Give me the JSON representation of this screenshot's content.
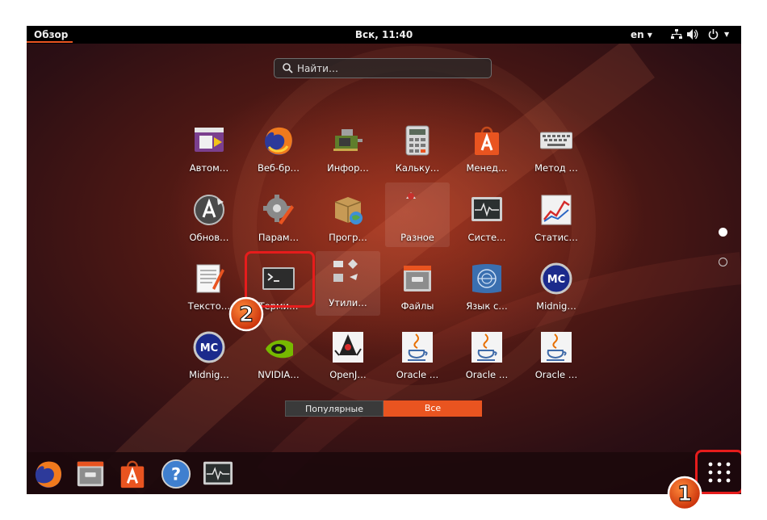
{
  "topbar": {
    "activities": "Обзор",
    "clock": "Вск, 11:40",
    "lang": "en"
  },
  "search": {
    "placeholder": "Найти…"
  },
  "apps": [
    {
      "label": "Автом…",
      "icon": "autostart-icon"
    },
    {
      "label": "Веб-бр…",
      "icon": "firefox-icon"
    },
    {
      "label": "Инфор…",
      "icon": "hardware-info-icon"
    },
    {
      "label": "Кальку…",
      "icon": "calculator-icon"
    },
    {
      "label": "Менед…",
      "icon": "software-center-icon"
    },
    {
      "label": "Метод …",
      "icon": "keyboard-icon"
    },
    {
      "label": "Обнов…",
      "icon": "software-updater-icon"
    },
    {
      "label": "Парам…",
      "icon": "settings-icon"
    },
    {
      "label": "Прогр…",
      "icon": "software-properties-icon"
    },
    {
      "label": "Разное",
      "icon": "misc-folder-icon"
    },
    {
      "label": "Систе…",
      "icon": "system-monitor-icon"
    },
    {
      "label": "Статис…",
      "icon": "statistics-icon"
    },
    {
      "label": "Тексто…",
      "icon": "text-editor-icon"
    },
    {
      "label": "Терми…",
      "icon": "terminal-icon"
    },
    {
      "label": "Утили…",
      "icon": "utilities-folder-icon"
    },
    {
      "label": "Файлы",
      "icon": "files-icon"
    },
    {
      "label": "Язык с…",
      "icon": "language-support-icon"
    },
    {
      "label": "Midnig…",
      "icon": "midnight-commander-icon"
    },
    {
      "label": "Midnig…",
      "icon": "midnight-commander-icon"
    },
    {
      "label": "NVIDIA…",
      "icon": "nvidia-icon"
    },
    {
      "label": "OpenJ…",
      "icon": "java-duke-icon"
    },
    {
      "label": "Oracle …",
      "icon": "java-cup-icon"
    },
    {
      "label": "Oracle …",
      "icon": "java-cup-icon"
    },
    {
      "label": "Oracle …",
      "icon": "java-cup-icon"
    }
  ],
  "tabs": {
    "frequent": "Популярные",
    "all": "Все"
  },
  "dock": [
    {
      "icon": "firefox-icon"
    },
    {
      "icon": "files-icon"
    },
    {
      "icon": "software-center-icon"
    },
    {
      "icon": "help-icon"
    },
    {
      "icon": "system-monitor-icon"
    }
  ],
  "annotations": {
    "badge_1": "1",
    "badge_2": "2"
  },
  "colors": {
    "accent": "#e95420",
    "callout": "#e61c1c"
  }
}
